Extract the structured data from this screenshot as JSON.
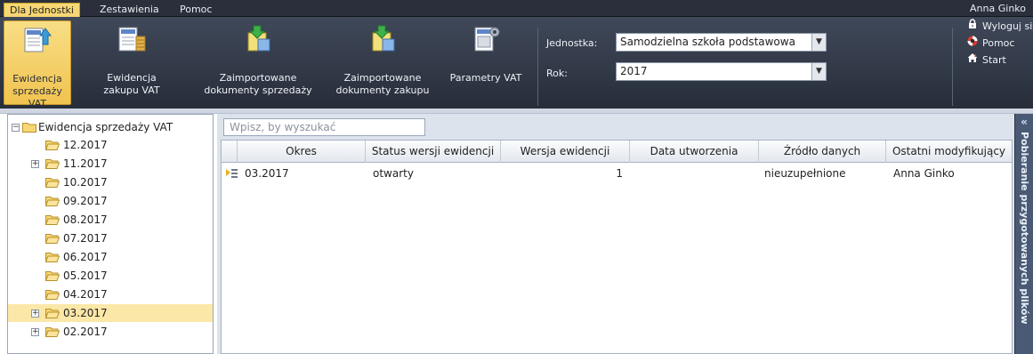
{
  "menubar": {
    "tabs": [
      "Dla Jednostki",
      "Zestawienia",
      "Pomoc"
    ],
    "user": "Anna Ginko"
  },
  "ribbon": {
    "buttons": [
      {
        "label": "Ewidencja sprzedaży VAT",
        "icon": "vat-sales-register-icon"
      },
      {
        "label": "Ewidencja zakupu VAT",
        "icon": "vat-purchase-register-icon"
      },
      {
        "label": "Zaimportowane dokumenty sprzedaży",
        "icon": "import-sales-documents-icon"
      },
      {
        "label": "Zaimportowane dokumenty zakupu",
        "icon": "import-purchase-documents-icon"
      },
      {
        "label": "Parametry VAT",
        "icon": "vat-parameters-icon"
      }
    ],
    "unit_label": "Jednostka:",
    "unit_value": "Samodzielna szkoła podstawowa",
    "year_label": "Rok:",
    "year_value": "2017",
    "links": [
      {
        "label": "Wyloguj się",
        "icon": "lock-icon"
      },
      {
        "label": "Pomoc",
        "icon": "lifebuoy-icon"
      },
      {
        "label": "Start",
        "icon": "home-icon"
      }
    ]
  },
  "tree": {
    "root": "Ewidencja sprzedaży VAT",
    "items": [
      "12.2017",
      "11.2017",
      "10.2017",
      "09.2017",
      "08.2017",
      "07.2017",
      "06.2017",
      "05.2017",
      "04.2017",
      "03.2017",
      "02.2017"
    ],
    "selected": "03.2017"
  },
  "main": {
    "search_placeholder": "Wpisz, by wyszukać",
    "columns": [
      "Okres",
      "Status wersji ewidencji",
      "Wersja ewidencji",
      "Data utworzenia",
      "Źródło danych",
      "Ostatni modyfikujący"
    ],
    "rows": [
      {
        "okres": "03.2017",
        "status": "otwarty",
        "wersja": "1",
        "data": "",
        "zrodlo": "nieuzupełnione",
        "modyfikujacy": "Anna Ginko"
      }
    ]
  },
  "side_panel": {
    "label": "Pobieranie przygotowanych plików",
    "collapse_glyph": "«"
  },
  "colors": {
    "accent": "#f1c350",
    "selected_row": "#fbe7a7",
    "ribbon_dark": "#272d39"
  }
}
